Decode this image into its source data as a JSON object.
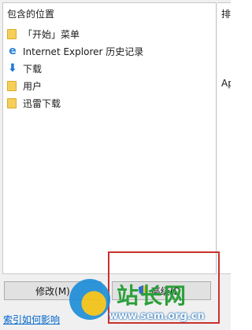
{
  "list": {
    "header": "包含的位置",
    "items": [
      {
        "icon": "folder-icon",
        "label": "「开始」菜单"
      },
      {
        "icon": "ie-icon",
        "label": "Internet Explorer 历史记录"
      },
      {
        "icon": "download-icon",
        "label": "下载"
      },
      {
        "icon": "folder-icon",
        "label": "用户"
      },
      {
        "icon": "folder-icon",
        "label": "迅雷下载"
      }
    ]
  },
  "right_panel": {
    "header": "排",
    "value": "Ap"
  },
  "buttons": {
    "modify": "修改(M)",
    "advanced": "高级(D)"
  },
  "link": "索引如何影响",
  "watermark": {
    "title": "站长网",
    "url": "www.sem.org.cn"
  },
  "colors": {
    "highlight": "#c9302c",
    "link": "#0066cc"
  }
}
